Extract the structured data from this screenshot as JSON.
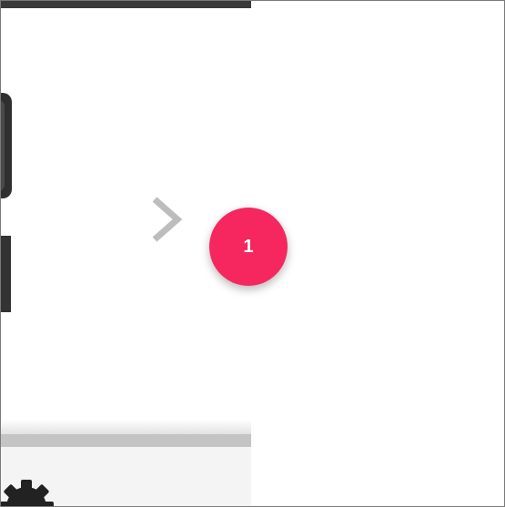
{
  "step_marker": {
    "number": "1",
    "color": "#f5275e"
  },
  "icons": {
    "next": "chevron-right-icon",
    "settings": "gear-icon"
  },
  "colors": {
    "top_bar": "#3a3a3a",
    "chevron": "#bdbdbd",
    "divider": "#c4c4c4",
    "gear": "#222222"
  }
}
